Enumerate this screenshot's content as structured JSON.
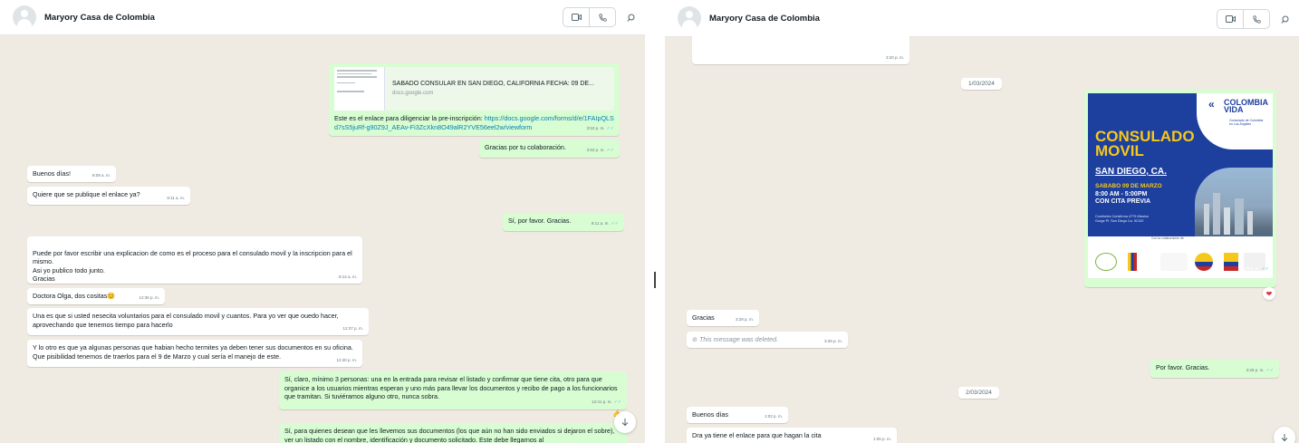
{
  "left": {
    "header": {
      "contact_name": "Maryory Casa de Colombia"
    },
    "messages": [
      {
        "id": "m1",
        "dir": "out",
        "preview_title": "SABADO CONSULAR EN SAN DIEGO, CALIFORNIA   FECHA: 09 DE...",
        "preview_domain": "docs.google.com",
        "text": "Este es el enlace para diligenciar la pre-inscripción: ",
        "link": "https://docs.google.com/forms/d/e/1FAIpQLSd7sS5juRf-g90Z9J_AEAv-Fi3ZcXkn8O49alR2YVE56eel2w/viewform",
        "time": "3:53 p. m."
      },
      {
        "id": "m2",
        "dir": "out",
        "text": "Gracias por tu colaboración.",
        "time": "3:53 p. m."
      },
      {
        "id": "m3",
        "dir": "in",
        "text": "Buenos días!",
        "time": "8:09 a. m."
      },
      {
        "id": "m4",
        "dir": "in",
        "text": "Quiere que se publique el enlace ya?",
        "time": "8:11 a. m."
      },
      {
        "id": "m5",
        "dir": "out",
        "text": "Sí, por favor. Gracias.",
        "time": "8:11 a. m."
      },
      {
        "id": "m6",
        "dir": "in",
        "text": "Puede por favor escribir una explicacion de como es el proceso para el consulado movil y la inscripcion para el mismo.\nAsi yo publico todo junto.\nGracias",
        "time": "8:14 a. m."
      },
      {
        "id": "m7",
        "dir": "in",
        "text": "Doctora Olga, dos cositas",
        "time": "12:36 p. m."
      },
      {
        "id": "m8",
        "dir": "in",
        "text": "Una es que si usted nesecita voluntarios para el consulado movil y cuantos. Para yo ver que ouedo hacer, aprovechando que tenemos tiempo para hacerlo",
        "time": "12:37 p. m."
      },
      {
        "id": "m9",
        "dir": "in",
        "text": "Y lo otro es que ya algunas personas que habian hecho termites ya deben tener sus documentos en su oficina. Que pisibilidad tenemos de traerlos para el 9 de Marzo y cual sería el manejo de este.",
        "time": "12:40 p. m."
      },
      {
        "id": "m10",
        "dir": "out",
        "text": "Sí, claro, mínimo 3 personas: una en la entrada para revisar el listado y confirmar que tiene cita, otro para que organice  a los usuarios mientras esperan y uno más para llevar los documentos y recibo de pago a los funcionarios que tramitan. Si tuviéramos alguno otro, nunca sobra.",
        "time": "12:41 p. m."
      },
      {
        "id": "m11",
        "dir": "out",
        "text": "Sí, para quienes desean que les llevemos sus documentos (los que aún no han sido enviados si dejaron el sobre), ver un listado con el nombre, identificación y documento solicitado. Este debe llegarnos al",
        "time": ""
      }
    ]
  },
  "right": {
    "header": {
      "contact_name": "Maryory Casa de Colombia"
    },
    "top_partial_time": "3:20 p. m.",
    "date_chips": [
      "1/03/2024",
      "2/03/2024"
    ],
    "flyer": {
      "logo_text": "COLOMBIA\nVIDA",
      "logo_sub": "Consulado de Colombia en Los Ángeles",
      "title": "CONSULADO\nMOVIL",
      "city": "SAN DIEGO, CA.",
      "date": "SABABO 09 DE MARZO",
      "hours": "8:00 AM - 5:00PM\nCON CITA PREVIA",
      "address": "Comfortes Corisfirma 4775 Mission Gorge Pl. San Diego Ca. 92120",
      "sponsor_label": "Con la colaboración de",
      "time": "3:29 p. m.",
      "reaction": "❤"
    },
    "messages": [
      {
        "id": "r1",
        "dir": "in",
        "text": "Gracias",
        "time": "3:29 p. m."
      },
      {
        "id": "r2",
        "dir": "in",
        "text": "This message was deleted.",
        "time": "3:29 p. m.",
        "deleted": true
      },
      {
        "id": "r3",
        "dir": "out",
        "text": "Por favor. Gracias.",
        "time": "3:29 p. m."
      },
      {
        "id": "r4",
        "dir": "in",
        "text": "Buenos días",
        "time": "1:02 p. m."
      },
      {
        "id": "r5",
        "dir": "in",
        "text": "Dra ya tiene el enlace para que hagan la cita",
        "time": "1:05 p. m."
      }
    ]
  },
  "icons": {
    "video": "video-camera-icon",
    "call": "phone-icon",
    "search": "search-icon",
    "scroll": "chevron-down-icon"
  },
  "colors": {
    "incoming": "#ffffff",
    "outgoing": "#d9fdd3",
    "wallpaper": "#efeae2",
    "read_check": "#53bdeb",
    "link": "#027eb5"
  }
}
